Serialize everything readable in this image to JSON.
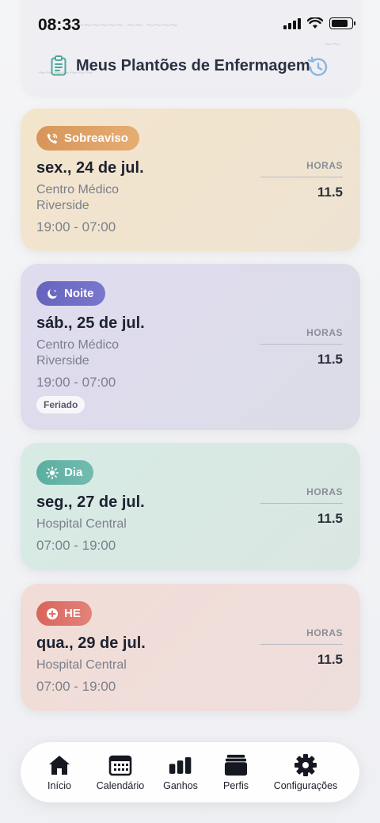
{
  "status_bar": {
    "time": "08:33"
  },
  "header": {
    "title": "Meus Plantões de Enfermagem"
  },
  "shifts": [
    {
      "type_label": "Sobreaviso",
      "date": "sex., 24 de jul.",
      "location": "Centro Médico Riverside",
      "time": "19:00 - 07:00",
      "hours_label": "HORAS",
      "hours": "11.5",
      "color": "#e0a266"
    },
    {
      "type_label": "Noite",
      "date": "sáb., 25 de jul.",
      "location": "Centro Médico Riverside",
      "time": "19:00 - 07:00",
      "tag": "Feriado",
      "hours_label": "HORAS",
      "hours": "11.5",
      "color": "#6f6dc4"
    },
    {
      "type_label": "Dia",
      "date": "seg., 27 de jul.",
      "location": "Hospital Central",
      "time": "07:00 - 19:00",
      "hours_label": "HORAS",
      "hours": "11.5",
      "color": "#64b4a7"
    },
    {
      "type_label": "HE",
      "date": "qua., 29 de jul.",
      "location": "Hospital Central",
      "time": "07:00 - 19:00",
      "hours_label": "HORAS",
      "hours": "11.5",
      "color": "#dd7068"
    }
  ],
  "tabbar": {
    "items": [
      {
        "label": "Início",
        "icon": "home-icon",
        "active": true
      },
      {
        "label": "Calendário",
        "icon": "calendar-icon"
      },
      {
        "label": "Ganhos",
        "icon": "bar-chart-icon"
      },
      {
        "label": "Perfis",
        "icon": "folders-icon"
      },
      {
        "label": "Configurações",
        "icon": "gear-icon"
      }
    ]
  }
}
